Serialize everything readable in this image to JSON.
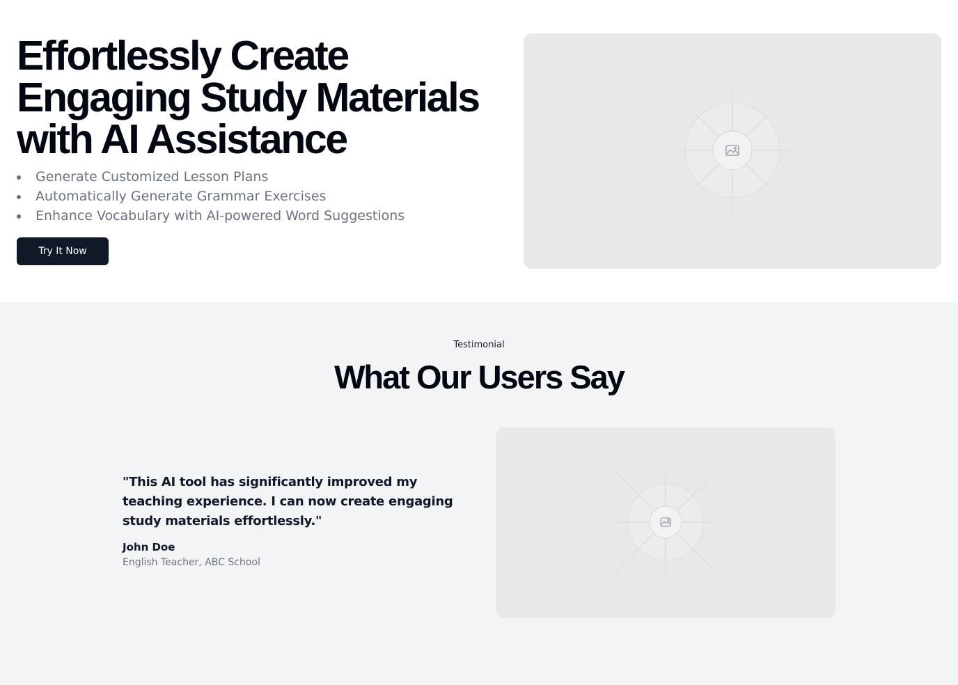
{
  "hero": {
    "title_lines": [
      "Effortlessly Create",
      "Engaging Study Materials",
      "with AI Assistance"
    ],
    "features": [
      "Generate Customized Lesson Plans",
      "Automatically Generate Grammar Exercises",
      "Enhance Vocabulary with AI-powered Word Suggestions"
    ],
    "cta_label": "Try It Now",
    "image_icon": "image-icon"
  },
  "testimonial": {
    "eyebrow": "Testimonial",
    "title": "What Our Users Say",
    "quote": "\"This AI tool has significantly improved my teaching experience. I can now create engaging study materials effortlessly.\"",
    "author": "John Doe",
    "role": "English Teacher, ABC School",
    "image_icon": "image-icon"
  },
  "colors": {
    "primary_button": "#111827",
    "muted_text": "#6b7280",
    "section_bg": "#f3f4f6",
    "placeholder_bg": "#e8e8e8"
  }
}
